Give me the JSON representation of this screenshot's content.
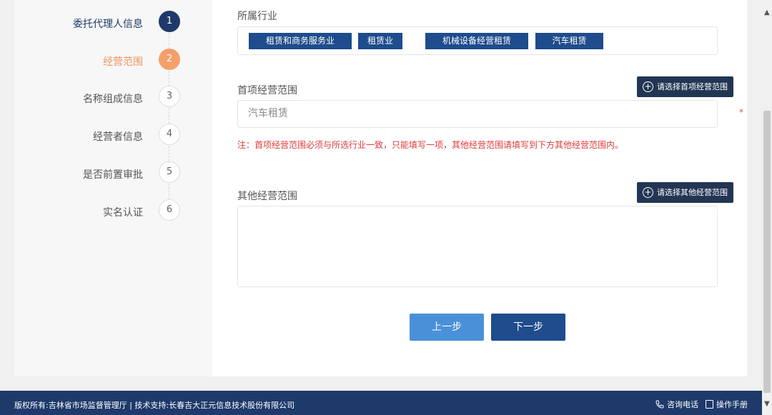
{
  "steps": [
    {
      "label": "委托代理人信息",
      "num": "1"
    },
    {
      "label": "经营范围",
      "num": "2"
    },
    {
      "label": "名称组成信息",
      "num": "3"
    },
    {
      "label": "经营者信息",
      "num": "4"
    },
    {
      "label": "是否前置审批",
      "num": "5"
    },
    {
      "label": "实名认证",
      "num": "6"
    }
  ],
  "industry": {
    "label": "所属行业",
    "tags": [
      "租赁和商务服务业",
      "租赁业",
      "机械设备经营租赁",
      "汽车租赁"
    ]
  },
  "first_scope": {
    "label": "首项经营范围",
    "select_button": "请选择首项经营范围",
    "value": "汽车租赁",
    "required_mark": "*",
    "note": "注：首项经营范围必须与所选行业一致，只能填写一项，其他经营范围请填写到下方其他经营范围内。"
  },
  "other_scope": {
    "label": "其他经营范围",
    "select_button": "请选择其他经营范围",
    "value": ""
  },
  "buttons": {
    "prev": "上一步",
    "next": "下一步"
  },
  "footer": {
    "copyright": "版权所有:吉林省市场监督管理厅 | 技术支持:长春吉大正元信息技术股份有限公司",
    "consult": "咨询电话",
    "manual": "操作手册"
  },
  "colors": {
    "primary": "#1e4c8c",
    "navy": "#1e3a6b",
    "accent": "#f5a06b",
    "note": "#e03b3b"
  }
}
